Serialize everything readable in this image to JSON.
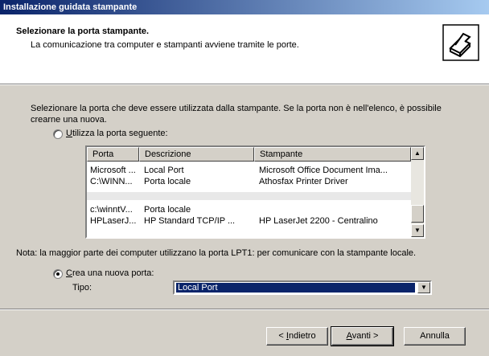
{
  "window": {
    "title": "Installazione guidata stampante"
  },
  "header": {
    "title": "Selezionare la porta stampante.",
    "subtitle": "La comunicazione tra computer e stampanti avviene tramite le porte.",
    "icon": "printer-icon"
  },
  "intro": "Selezionare la porta che deve essere utilizzata dalla stampante. Se la porta non è nell'elenco, è possibile crearne una nuova.",
  "use_existing": {
    "label": "Utilizza la porta seguente:",
    "checked": false
  },
  "ports": {
    "columns": [
      "Porta",
      "Descrizione",
      "Stampante"
    ],
    "rows": [
      [
        "Microsoft ...",
        "Local Port",
        "Microsoft Office Document Ima..."
      ],
      [
        "C:\\WINN...",
        "Porta locale",
        "Athosfax Printer Driver"
      ],
      [
        "",
        "",
        ""
      ],
      [
        "c:\\winntV...",
        "Porta locale",
        ""
      ],
      [
        "HPLaserJ...",
        "HP Standard TCP/IP ...",
        "HP LaserJet 2200 - Centralino"
      ]
    ]
  },
  "note": "Nota: la maggior parte dei computer utilizzano la porta LPT1: per comunicare con la stampante locale.",
  "create_new": {
    "label": "Crea una nuova porta:",
    "checked": true
  },
  "tipo": {
    "label": "Tipo:",
    "value": "Local Port"
  },
  "buttons": {
    "back": "< Indietro",
    "next": "Avanti >",
    "cancel": "Annulla"
  }
}
